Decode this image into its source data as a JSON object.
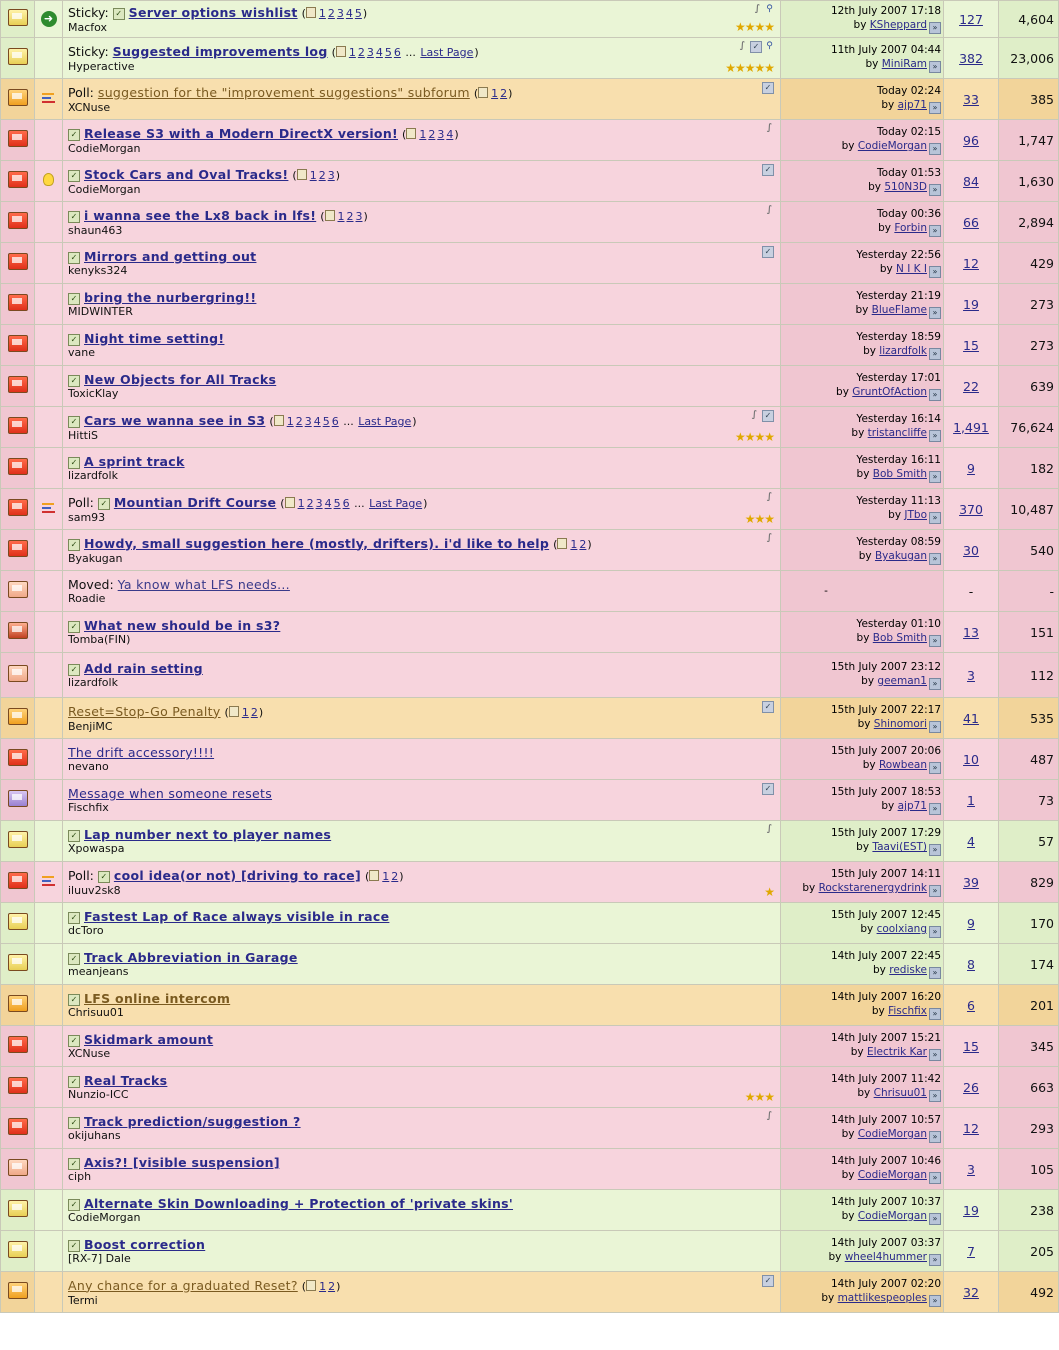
{
  "threads": [
    {
      "bg": "green",
      "folder": "yellow",
      "icon": "arrow",
      "prefix": "Sticky:",
      "check": true,
      "title": "Server options wishlist",
      "pages": [
        "1",
        "2",
        "3",
        "4",
        "5"
      ],
      "last_page": "",
      "starter": "Macfox",
      "clip": true,
      "checkmark": false,
      "pin": true,
      "stars": "★★★★",
      "date": "12th July 2007 17:18",
      "by": "by",
      "user": "KSheppard",
      "replies": "127",
      "views": "4,604"
    },
    {
      "bg": "green",
      "folder": "yellow",
      "icon": "",
      "prefix": "Sticky:",
      "check": false,
      "title": "Suggested improvements log",
      "pages": [
        "1",
        "2",
        "3",
        "4",
        "5",
        "6"
      ],
      "last_page": "Last Page",
      "starter": "Hyperactive",
      "clip": true,
      "checkmark": true,
      "pin": true,
      "stars": "★★★★★",
      "date": "11th July 2007 04:44",
      "by": "by",
      "user": "MiniRam",
      "replies": "382",
      "views": "23,006"
    },
    {
      "bg": "orange",
      "folder": "orange",
      "icon": "poll",
      "prefix": "Poll:",
      "check": false,
      "title": "suggestion for the \"improvement suggestions\" subforum",
      "pages": [
        "1",
        "2"
      ],
      "last_page": "",
      "starter": "XCNuse",
      "clip": false,
      "checkmark": true,
      "pin": false,
      "stars": "",
      "date": "Today 02:24",
      "by": "by",
      "user": "ajp71",
      "replies": "33",
      "views": "385",
      "plain": true
    },
    {
      "bg": "pink",
      "folder": "red",
      "icon": "",
      "prefix": "",
      "check": true,
      "title": "Release S3 with a Modern DirectX version!",
      "pages": [
        "1",
        "2",
        "3",
        "4"
      ],
      "last_page": "",
      "starter": "CodieMorgan",
      "clip": true,
      "checkmark": false,
      "pin": false,
      "stars": "",
      "date": "Today 02:15",
      "by": "by",
      "user": "CodieMorgan",
      "replies": "96",
      "views": "1,747"
    },
    {
      "bg": "pink",
      "folder": "red",
      "icon": "bulb",
      "prefix": "",
      "check": true,
      "title": "Stock Cars and Oval Tracks!",
      "pages": [
        "1",
        "2",
        "3"
      ],
      "last_page": "",
      "starter": "CodieMorgan",
      "clip": false,
      "checkmark": true,
      "pin": false,
      "stars": "",
      "date": "Today 01:53",
      "by": "by",
      "user": "510N3D",
      "replies": "84",
      "views": "1,630"
    },
    {
      "bg": "pink",
      "folder": "red",
      "icon": "",
      "prefix": "",
      "check": true,
      "title": "i wanna see the Lx8 back in lfs!",
      "pages": [
        "1",
        "2",
        "3"
      ],
      "last_page": "",
      "starter": "shaun463",
      "clip": true,
      "checkmark": false,
      "pin": false,
      "stars": "",
      "date": "Today 00:36",
      "by": "by",
      "user": "Forbin",
      "replies": "66",
      "views": "2,894"
    },
    {
      "bg": "pink",
      "folder": "red",
      "icon": "",
      "prefix": "",
      "check": true,
      "title": "Mirrors and getting out",
      "pages": [],
      "last_page": "",
      "starter": "kenyks324",
      "clip": false,
      "checkmark": true,
      "pin": false,
      "stars": "",
      "date": "Yesterday 22:56",
      "by": "by",
      "user": "N I K I",
      "replies": "12",
      "views": "429"
    },
    {
      "bg": "pink",
      "folder": "red",
      "icon": "",
      "prefix": "",
      "check": true,
      "title": "bring the nurbergring!!",
      "pages": [],
      "last_page": "",
      "starter": "MIDWINTER",
      "clip": false,
      "checkmark": false,
      "pin": false,
      "stars": "",
      "date": "Yesterday 21:19",
      "by": "by",
      "user": "BlueFlame",
      "replies": "19",
      "views": "273"
    },
    {
      "bg": "pink",
      "folder": "red",
      "icon": "",
      "prefix": "",
      "check": true,
      "title": "Night time setting!",
      "pages": [],
      "last_page": "",
      "starter": "vane",
      "clip": false,
      "checkmark": false,
      "pin": false,
      "stars": "",
      "date": "Yesterday 18:59",
      "by": "by",
      "user": "lizardfolk",
      "replies": "15",
      "views": "273"
    },
    {
      "bg": "pink",
      "folder": "red",
      "icon": "",
      "prefix": "",
      "check": true,
      "title": "New Objects for All Tracks",
      "pages": [],
      "last_page": "",
      "starter": "ToxicKlay",
      "clip": false,
      "checkmark": false,
      "pin": false,
      "stars": "",
      "date": "Yesterday 17:01",
      "by": "by",
      "user": "GruntOfAction",
      "replies": "22",
      "views": "639"
    },
    {
      "bg": "pink",
      "folder": "red",
      "icon": "",
      "prefix": "",
      "check": true,
      "title": "Cars we wanna see in S3",
      "pages": [
        "1",
        "2",
        "3",
        "4",
        "5",
        "6"
      ],
      "last_page": "Last Page",
      "starter": "HittiS",
      "clip": true,
      "checkmark": true,
      "pin": false,
      "stars": "★★★★",
      "date": "Yesterday 16:14",
      "by": "by",
      "user": "tristancliffe",
      "replies": "1,491",
      "views": "76,624"
    },
    {
      "bg": "pink",
      "folder": "red",
      "icon": "",
      "prefix": "",
      "check": true,
      "title": "A sprint track",
      "pages": [],
      "last_page": "",
      "starter": "lizardfolk",
      "clip": false,
      "checkmark": false,
      "pin": false,
      "stars": "",
      "date": "Yesterday 16:11",
      "by": "by",
      "user": "Bob Smith",
      "replies": "9",
      "views": "182"
    },
    {
      "bg": "pink",
      "folder": "red",
      "icon": "poll",
      "prefix": "Poll:",
      "check": true,
      "title": "Mountian Drift Course",
      "pages": [
        "1",
        "2",
        "3",
        "4",
        "5",
        "6"
      ],
      "last_page": "Last Page",
      "starter": "sam93",
      "clip": true,
      "checkmark": false,
      "pin": false,
      "stars": "★★★",
      "date": "Yesterday 11:13",
      "by": "by",
      "user": "JTbo",
      "replies": "370",
      "views": "10,487"
    },
    {
      "bg": "pink",
      "folder": "red",
      "icon": "",
      "prefix": "",
      "check": true,
      "title": "Howdy, small suggestion here (mostly, drifters). i'd like to help",
      "pages": [
        "1",
        "2"
      ],
      "last_page": "",
      "starter": "Byakugan",
      "clip": true,
      "checkmark": false,
      "pin": false,
      "stars": "",
      "date": "Yesterday 08:59",
      "by": "by",
      "user": "Byakugan",
      "replies": "30",
      "views": "540"
    },
    {
      "bg": "pink",
      "folder": "pale",
      "icon": "",
      "prefix": "Moved:",
      "check": false,
      "title": "Ya know what LFS needs...",
      "pages": [],
      "last_page": "",
      "starter": "Roadie",
      "clip": false,
      "checkmark": false,
      "pin": false,
      "stars": "",
      "date": "-",
      "by": "",
      "user": "",
      "replies": "-",
      "views": "-",
      "plain": true,
      "moved": true
    },
    {
      "bg": "pink",
      "folder": "locked",
      "icon": "",
      "prefix": "",
      "check": true,
      "title": "What new should be in s3?",
      "pages": [],
      "last_page": "",
      "starter": "Tomba(FIN)",
      "clip": false,
      "checkmark": false,
      "pin": false,
      "stars": "",
      "date": "Yesterday 01:10",
      "by": "by",
      "user": "Bob Smith",
      "replies": "13",
      "views": "151"
    },
    {
      "bg": "pink",
      "folder": "pale",
      "icon": "",
      "prefix": "",
      "check": true,
      "title": "Add rain setting",
      "pages": [],
      "last_page": "",
      "starter": "lizardfolk",
      "clip": false,
      "checkmark": false,
      "pin": false,
      "stars": "",
      "date": "15th July 2007 23:12",
      "by": "by",
      "user": "geeman1",
      "replies": "3",
      "views": "112",
      "tall": true
    },
    {
      "bg": "orange",
      "folder": "orange",
      "icon": "",
      "prefix": "",
      "check": false,
      "title": "Reset=Stop-Go Penalty",
      "pages": [
        "1",
        "2"
      ],
      "last_page": "",
      "starter": "BenjiMC",
      "clip": false,
      "checkmark": true,
      "pin": false,
      "stars": "",
      "date": "15th July 2007 22:17",
      "by": "by",
      "user": "Shinomori",
      "replies": "41",
      "views": "535",
      "plain": true
    },
    {
      "bg": "pink",
      "folder": "red",
      "icon": "",
      "prefix": "",
      "check": false,
      "title": "The drift accessory!!!!",
      "pages": [],
      "last_page": "",
      "starter": "nevano",
      "clip": false,
      "checkmark": false,
      "pin": false,
      "stars": "",
      "date": "15th July 2007 20:06",
      "by": "by",
      "user": "Rowbean",
      "replies": "10",
      "views": "487",
      "plain": true
    },
    {
      "bg": "pink",
      "folder": "purple",
      "icon": "",
      "prefix": "",
      "check": false,
      "title": "Message when someone resets",
      "pages": [],
      "last_page": "",
      "starter": "Fischfix",
      "clip": false,
      "checkmark": true,
      "pin": false,
      "stars": "",
      "date": "15th July 2007 18:53",
      "by": "by",
      "user": "ajp71",
      "replies": "1",
      "views": "73",
      "plain": true
    },
    {
      "bg": "green",
      "folder": "yellow",
      "icon": "",
      "prefix": "",
      "check": true,
      "title": "Lap number next to player names",
      "pages": [],
      "last_page": "",
      "starter": "Xpowaspa",
      "clip": true,
      "checkmark": false,
      "pin": false,
      "stars": "",
      "date": "15th July 2007 17:29",
      "by": "by",
      "user": "Taavi(EST)",
      "replies": "4",
      "views": "57"
    },
    {
      "bg": "pink",
      "folder": "red",
      "icon": "poll",
      "prefix": "Poll:",
      "check": true,
      "title": "cool idea(or not) [driving to race]",
      "pages": [
        "1",
        "2"
      ],
      "last_page": "",
      "starter": "iluuv2sk8",
      "clip": false,
      "checkmark": false,
      "pin": false,
      "stars": "★",
      "date": "15th July 2007 14:11",
      "by": "by",
      "user": "Rockstarenergydrink",
      "replies": "39",
      "views": "829"
    },
    {
      "bg": "green",
      "folder": "yellow",
      "icon": "",
      "prefix": "",
      "check": true,
      "title": "Fastest Lap of Race always visible in race",
      "pages": [],
      "last_page": "",
      "starter": "dcToro",
      "clip": false,
      "checkmark": false,
      "pin": false,
      "stars": "",
      "date": "15th July 2007 12:45",
      "by": "by",
      "user": "coolxiang",
      "replies": "9",
      "views": "170"
    },
    {
      "bg": "green",
      "folder": "yellow",
      "icon": "",
      "prefix": "",
      "check": true,
      "title": "Track Abbreviation in Garage",
      "pages": [],
      "last_page": "",
      "starter": "meanjeans",
      "clip": false,
      "checkmark": false,
      "pin": false,
      "stars": "",
      "date": "14th July 2007 22:45",
      "by": "by",
      "user": "rediske",
      "replies": "8",
      "views": "174"
    },
    {
      "bg": "orange",
      "folder": "orange",
      "icon": "",
      "prefix": "",
      "check": true,
      "title": "LFS online intercom",
      "pages": [],
      "last_page": "",
      "starter": "Chrisuu01",
      "clip": false,
      "checkmark": false,
      "pin": false,
      "stars": "",
      "date": "14th July 2007 16:20",
      "by": "by",
      "user": "Fischfix",
      "replies": "6",
      "views": "201"
    },
    {
      "bg": "pink",
      "folder": "red",
      "icon": "",
      "prefix": "",
      "check": true,
      "title": "Skidmark amount",
      "pages": [],
      "last_page": "",
      "starter": "XCNuse",
      "clip": false,
      "checkmark": false,
      "pin": false,
      "stars": "",
      "date": "14th July 2007 15:21",
      "by": "by",
      "user": "Electrik Kar",
      "replies": "15",
      "views": "345"
    },
    {
      "bg": "pink",
      "folder": "red",
      "icon": "",
      "prefix": "",
      "check": true,
      "title": "Real Tracks",
      "pages": [],
      "last_page": "",
      "starter": "Nunzio-ICC",
      "clip": false,
      "checkmark": false,
      "pin": false,
      "stars": "★★★",
      "date": "14th July 2007 11:42",
      "by": "by",
      "user": "Chrisuu01",
      "replies": "26",
      "views": "663"
    },
    {
      "bg": "pink",
      "folder": "red",
      "icon": "",
      "prefix": "",
      "check": true,
      "title": "Track prediction/suggestion ?",
      "pages": [],
      "last_page": "",
      "starter": "okijuhans",
      "clip": true,
      "checkmark": false,
      "pin": false,
      "stars": "",
      "date": "14th July 2007 10:57",
      "by": "by",
      "user": "CodieMorgan",
      "replies": "12",
      "views": "293"
    },
    {
      "bg": "pink",
      "folder": "pale",
      "icon": "",
      "prefix": "",
      "check": true,
      "title": "Axis?! [visible suspension]",
      "pages": [],
      "last_page": "",
      "starter": "ciph",
      "clip": false,
      "checkmark": false,
      "pin": false,
      "stars": "",
      "date": "14th July 2007 10:46",
      "by": "by",
      "user": "CodieMorgan",
      "replies": "3",
      "views": "105"
    },
    {
      "bg": "green",
      "folder": "yellow",
      "icon": "",
      "prefix": "",
      "check": true,
      "title": "Alternate Skin Downloading + Protection of 'private skins'",
      "pages": [],
      "last_page": "",
      "starter": "CodieMorgan",
      "clip": false,
      "checkmark": false,
      "pin": false,
      "stars": "",
      "date": "14th July 2007 10:37",
      "by": "by",
      "user": "CodieMorgan",
      "replies": "19",
      "views": "238"
    },
    {
      "bg": "green",
      "folder": "yellow",
      "icon": "",
      "prefix": "",
      "check": true,
      "title": "Boost correction",
      "pages": [],
      "last_page": "",
      "starter": "[RX-7] Dale",
      "clip": false,
      "checkmark": false,
      "pin": false,
      "stars": "",
      "date": "14th July 2007 03:37",
      "by": "by",
      "user": "wheel4hummer",
      "replies": "7",
      "views": "205"
    },
    {
      "bg": "orange",
      "folder": "orange",
      "icon": "",
      "prefix": "",
      "check": false,
      "title": "Any chance for a graduated Reset?",
      "pages": [
        "1",
        "2"
      ],
      "last_page": "",
      "starter": "Termi",
      "clip": false,
      "checkmark": true,
      "pin": false,
      "stars": "",
      "date": "14th July 2007 02:20",
      "by": "by",
      "user": "mattlikespeoples",
      "replies": "32",
      "views": "492",
      "plain": true
    }
  ]
}
